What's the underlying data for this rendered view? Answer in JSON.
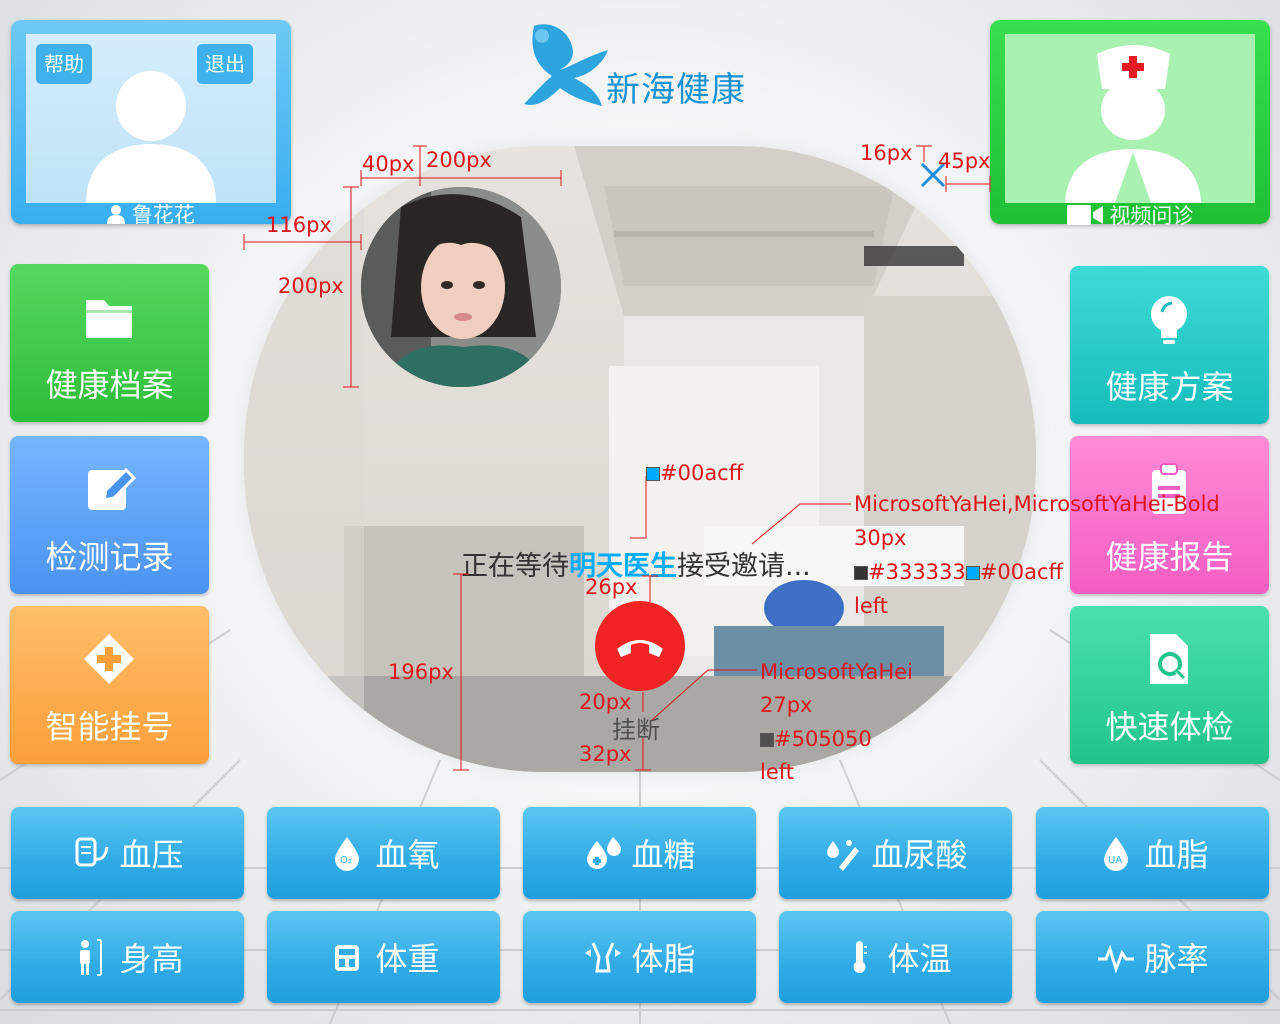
{
  "logo": {
    "text": "新海健康"
  },
  "user_card": {
    "help_label": "帮助",
    "exit_label": "退出",
    "name": "鲁花花"
  },
  "doctor_card": {
    "label": "视频问诊"
  },
  "left_tiles": [
    {
      "label": "健康档案",
      "icon": "folder-icon"
    },
    {
      "label": "检测记录",
      "icon": "edit-icon"
    },
    {
      "label": "智能挂号",
      "icon": "medical-plus-icon"
    }
  ],
  "right_tiles": [
    {
      "label": "健康方案",
      "icon": "lightbulb-icon"
    },
    {
      "label": "健康报告",
      "icon": "clipboard-icon"
    },
    {
      "label": "快速体检",
      "icon": "document-search-icon"
    }
  ],
  "call": {
    "waiting_prefix": "正在等待",
    "doctor_name": "明天医生",
    "waiting_suffix": "接受邀请...",
    "hangup_label": "挂断"
  },
  "annotations": {
    "a40": "40px",
    "a200w": "200px",
    "a116": "116px",
    "a200h": "200px",
    "a16": "16px",
    "a45": "45px",
    "accent": "#00acff",
    "font1_family": "MicrosoftYaHei,MicrosoftYaHei-Bold",
    "font1_size": "30px",
    "font1_color1": "#333333",
    "font1_color2": "#00acff",
    "font1_align": "left",
    "a26": "26px",
    "a196": "196px",
    "a20": "20px",
    "a32": "32px",
    "font2_family": "MicrosoftYaHei",
    "font2_size": "27px",
    "font2_color": "#505050",
    "font2_align": "left"
  },
  "measure_row1": [
    {
      "label": "血压",
      "icon": "blood-pressure-icon"
    },
    {
      "label": "血氧",
      "icon": "blood-oxygen-icon"
    },
    {
      "label": "血糖",
      "icon": "blood-sugar-icon"
    },
    {
      "label": "血尿酸",
      "icon": "uric-acid-icon"
    },
    {
      "label": "血脂",
      "icon": "blood-lipid-icon"
    }
  ],
  "measure_row2": [
    {
      "label": "身高",
      "icon": "height-icon"
    },
    {
      "label": "体重",
      "icon": "scale-icon"
    },
    {
      "label": "体脂",
      "icon": "body-fat-icon"
    },
    {
      "label": "体温",
      "icon": "thermometer-icon"
    },
    {
      "label": "脉率",
      "icon": "pulse-icon"
    }
  ],
  "colors": {
    "accent": "#00acff",
    "text_dark": "#333333",
    "text_gray": "#505050",
    "hangup": "#f22323",
    "annotation": "#e0141b"
  }
}
